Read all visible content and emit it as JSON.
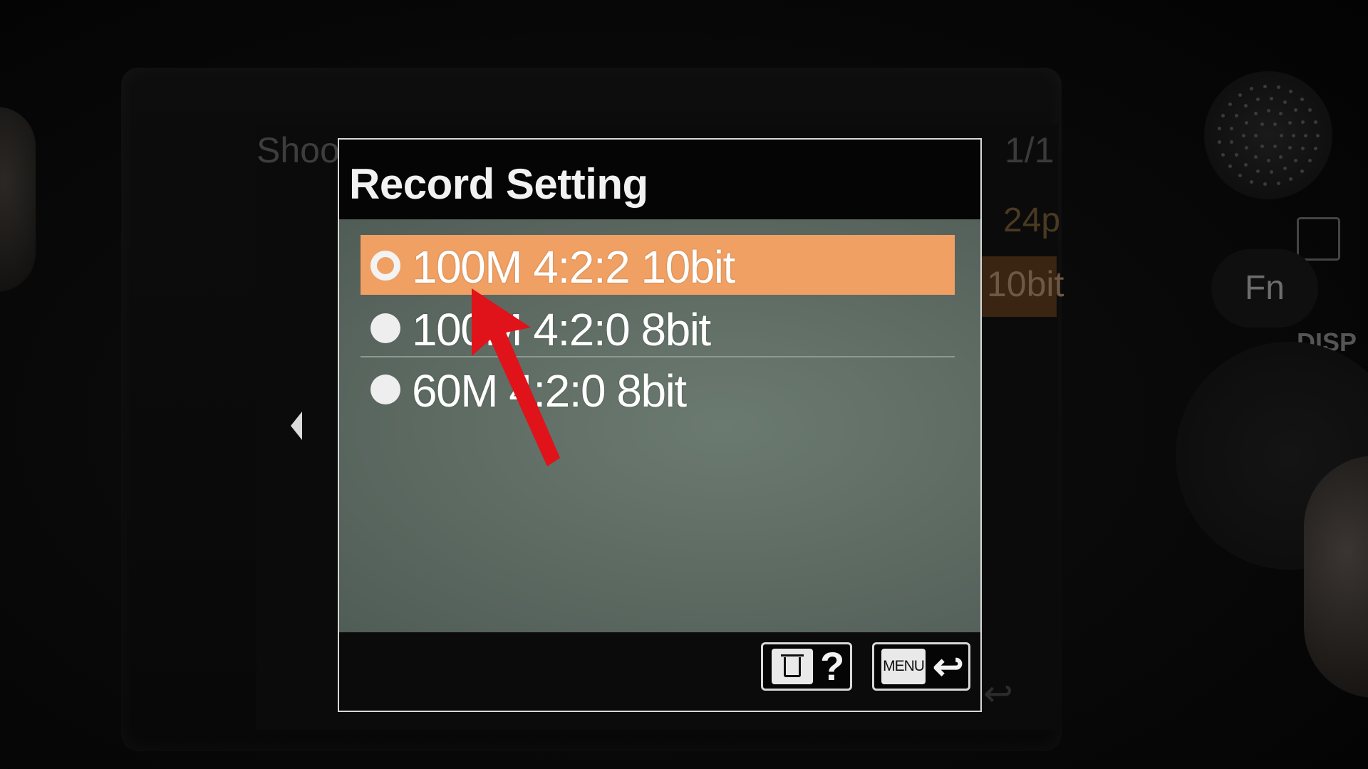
{
  "dialog": {
    "title": "Record Setting",
    "options": [
      {
        "label": "100M 4:2:2 10bit",
        "selected": true
      },
      {
        "label": "100M 4:2:0 8bit",
        "selected": false
      },
      {
        "label": "60M 4:2:0 8bit",
        "selected": false
      }
    ],
    "footer": {
      "delete_help_icon": "trash-icon",
      "help_glyph": "?",
      "menu_label": "MENU",
      "back_glyph": "↩"
    }
  },
  "background_menu": {
    "title": "Shoot",
    "page": "1/1",
    "value_1": "24p",
    "value_2": "10bit",
    "back_glyph": "↩"
  },
  "camera": {
    "fn_label": "Fn",
    "disp_label": "DISP"
  },
  "colors": {
    "selection": "#f0a063",
    "pointer": "#e0121a",
    "dialog_body": "#5d6a62"
  }
}
